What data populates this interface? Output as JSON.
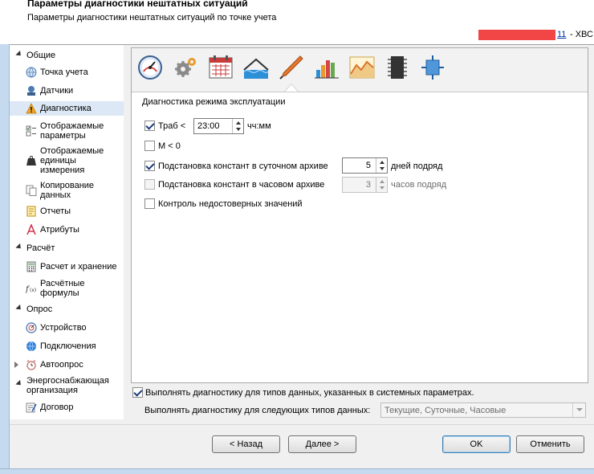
{
  "header": {
    "title": "Параметры диагностики нештатных ситуаций",
    "subtitle": "Параметры диагностики нештатных ситуаций по точке учета",
    "object_link": "11",
    "object_rest": "- ХВС"
  },
  "sidebar": {
    "groups": [
      {
        "label": "Общие",
        "items": [
          {
            "label": "Точка учета",
            "icon": "globe-icon"
          },
          {
            "label": "Датчики",
            "icon": "sensor-icon"
          },
          {
            "label": "Диагностика",
            "icon": "warning-icon",
            "selected": true
          },
          {
            "label": "Отображаемые\nпараметры",
            "icon": "checklist-icon"
          },
          {
            "label": "Отображаемые\nединицы\nизмерения",
            "icon": "weight-icon"
          },
          {
            "label": "Копирование\nданных",
            "icon": "copy-icon"
          },
          {
            "label": "Отчеты",
            "icon": "report-icon"
          },
          {
            "label": "Атрибуты",
            "icon": "attribute-icon"
          }
        ]
      },
      {
        "label": "Расчёт",
        "items": [
          {
            "label": "Расчет и хранение",
            "icon": "calculator-icon"
          },
          {
            "label": "Расчётные\nформулы",
            "icon": "formula-icon"
          }
        ]
      },
      {
        "label": "Опрос",
        "items": [
          {
            "label": "Устройство",
            "icon": "device-icon"
          },
          {
            "label": "Подключения",
            "icon": "connection-icon"
          },
          {
            "label": "Автоопрос",
            "icon": "alarm-clock-icon"
          }
        ]
      },
      {
        "label": "Энергоснабжающая\nорганизация",
        "items": [
          {
            "label": "Договор",
            "icon": "contract-icon"
          }
        ]
      }
    ]
  },
  "toolbar": {
    "icons": [
      "gauge-icon",
      "gears-icon",
      "calendar-icon",
      "water-level-icon",
      "pen-icon",
      "bar-chart-icon",
      "area-chart-icon",
      "chip-icon",
      "module-icon"
    ],
    "active_index": 4
  },
  "main": {
    "section_title": "Диагностика режима эксплуатации",
    "options": {
      "traб": {
        "label": "Траб <",
        "checked": true,
        "value": "23:00",
        "unit": "чч:мм"
      },
      "m_lt_0": {
        "label": "M < 0",
        "checked": false
      },
      "daily_subst": {
        "label": "Подстановка констант в суточном архиве",
        "checked": true,
        "value": "5",
        "unit": "дней подряд"
      },
      "hourly_subst": {
        "label": "Подстановка констант в часовом архиве",
        "checked": false,
        "value": "3",
        "unit": "часов подряд"
      },
      "invalid_control": {
        "label": "Контроль недостоверных значений",
        "checked": false
      }
    }
  },
  "bottom": {
    "system_check_label": "Выполнять диагностику для типов данных, указанных в системных параметрах.",
    "system_check_checked": true,
    "types_label": "Выполнять диагностику для следующих типов данных:",
    "types_value": "Текущие, Суточные, Часовые"
  },
  "footer": {
    "back": "< Назад",
    "next": "Далее >",
    "ok": "OK",
    "cancel": "Отменить"
  },
  "colors": {
    "selection": "#dce8f5",
    "redaction": "#f24646",
    "primary_border": "#3c7fb1"
  }
}
